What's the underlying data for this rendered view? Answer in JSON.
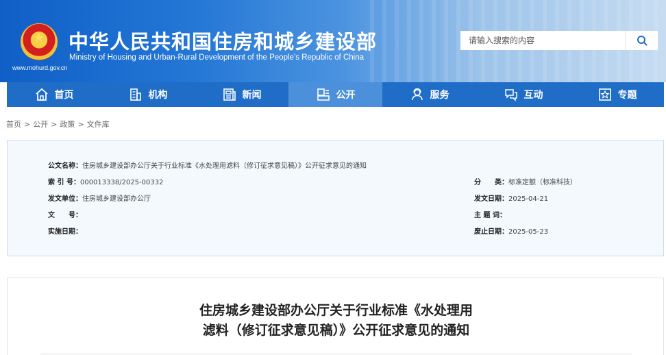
{
  "header": {
    "title": "中华人民共和国住房和城乡建设部",
    "subtitle": "Ministry of Housing and Urban-Rural Development of the People’s Republic of China",
    "url": "www.mohurd.gov.cn",
    "emblem_icon": "national-emblem-icon",
    "search_placeholder": "请输入搜索的内容",
    "search_value": "",
    "search_icon": "search-icon"
  },
  "nav": {
    "items": [
      {
        "label": "首页",
        "icon": "home-icon"
      },
      {
        "label": "机构",
        "icon": "organization-icon"
      },
      {
        "label": "新闻",
        "icon": "news-icon"
      },
      {
        "label": "公开",
        "icon": "disclosure-icon"
      },
      {
        "label": "服务",
        "icon": "service-icon"
      },
      {
        "label": "互动",
        "icon": "interaction-icon"
      },
      {
        "label": "专题",
        "icon": "topic-icon"
      }
    ],
    "active": "公开",
    "active_color": "#4c90db",
    "bar_color": "#1f6dc6"
  },
  "breadcrumb": {
    "items": [
      "首页",
      "公开",
      "政策",
      "文件库"
    ],
    "separator": ">"
  },
  "doc_info": {
    "name_label": "公文名称：",
    "name_value": "住房城乡建设部办公厅关于行业标准《水处理用滤料（修订征求意见稿）》公开征求意见的通知",
    "index_label": "索 引 号：",
    "index_value": "000013338/2025-00332",
    "category_label": "分　　类：",
    "category_value": "标准定额（标准科技）",
    "issuer_label": "发文单位：",
    "issuer_value": "住房城乡建设部办公厅",
    "date_label": "发文日期：",
    "date_value": "2025-04-21",
    "docno_label": "文　　号：",
    "docno_value": "",
    "subject_label": "主 题 词：",
    "subject_value": "",
    "effective_label": "实施日期：",
    "effective_value": "",
    "expiry_label": "废止日期：",
    "expiry_value": "2025-05-23"
  },
  "article": {
    "title_line1": "住房城乡建设部办公厅关于行业标准《水处理用",
    "title_line2": "滤料（修订征求意见稿）》公开征求意见的通知"
  }
}
